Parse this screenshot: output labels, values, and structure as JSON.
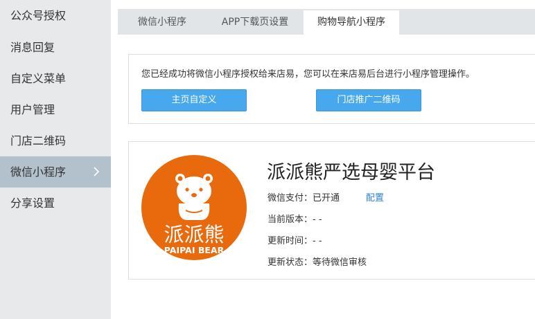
{
  "sidebar": {
    "items": [
      {
        "label": "公众号授权"
      },
      {
        "label": "消息回复"
      },
      {
        "label": "自定义菜单"
      },
      {
        "label": "用户管理"
      },
      {
        "label": "门店二维码"
      },
      {
        "label": "微信小程序"
      },
      {
        "label": "分享设置"
      }
    ],
    "active_index": 5
  },
  "tabs": [
    {
      "label": "微信小程序"
    },
    {
      "label": "APP下载页设置"
    },
    {
      "label": "购物导航小程序"
    }
  ],
  "auth": {
    "notice": "您已经成功将微信小程序授权给来店易，您可以在来店易后台进行小程序管理操作。",
    "home_custom_button": "主页自定义",
    "store_qr_button": "门店推广二维码"
  },
  "mini_program": {
    "logo_text_cn": "派派熊",
    "logo_text_en": "PAIPAI BEAR",
    "logo_color": "#e96a0c",
    "name": "派派熊严选母婴平台",
    "pay_label": "微信支付：",
    "pay_value": "已开通",
    "config_link": "配置",
    "version_label": "当前版本：",
    "version_value": "- -",
    "update_time_label": "更新时间：",
    "update_time_value": "- -",
    "update_status_label": "更新状态：",
    "update_status_value": "等待微信审核"
  },
  "colors": {
    "sidebar_bg": "#e7e9eb",
    "sidebar_active": "#b3c1cc",
    "button": "#47a8ee",
    "link": "#2b82d8"
  }
}
